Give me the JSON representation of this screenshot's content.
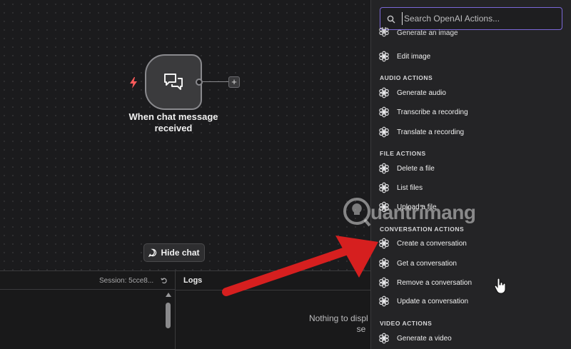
{
  "canvas": {
    "trigger_node": {
      "label": "When chat message received",
      "icon": "chat-bubbles-icon"
    },
    "hide_chat_button": {
      "label": "Hide chat",
      "icon": "chat-icon"
    }
  },
  "bottom_panel": {
    "session_label": "Session: 5cce8...",
    "logs_title": "Logs",
    "empty_message": "Nothing to displ workflow to se"
  },
  "actions_panel": {
    "search": {
      "placeholder": "Search OpenAI Actions...",
      "value": ""
    },
    "partial_top_item": "Generate an image",
    "image_actions": [
      {
        "label": "Edit image",
        "icon": "openai-icon"
      }
    ],
    "audio_actions": {
      "heading": "AUDIO ACTIONS",
      "items": [
        {
          "label": "Generate audio",
          "icon": "openai-icon"
        },
        {
          "label": "Transcribe a recording",
          "icon": "openai-icon"
        },
        {
          "label": "Translate a recording",
          "icon": "openai-icon"
        }
      ]
    },
    "file_actions": {
      "heading": "FILE ACTIONS",
      "items": [
        {
          "label": "Delete a file",
          "icon": "openai-icon"
        },
        {
          "label": "List files",
          "icon": "openai-icon"
        },
        {
          "label": "Upload a file",
          "icon": "openai-icon"
        }
      ]
    },
    "conversation_actions": {
      "heading": "CONVERSATION ACTIONS",
      "items": [
        {
          "label": "Create a conversation",
          "icon": "openai-icon"
        },
        {
          "label": "Get a conversation",
          "icon": "openai-icon"
        },
        {
          "label": "Remove a conversation",
          "icon": "openai-icon"
        },
        {
          "label": "Update a conversation",
          "icon": "openai-icon"
        }
      ]
    },
    "video_actions": {
      "heading": "VIDEO ACTIONS",
      "items": [
        {
          "label": "Generate a video",
          "icon": "openai-icon"
        }
      ]
    }
  },
  "watermark": {
    "text": "uantrimang"
  },
  "colors": {
    "accent": "#7b68d8",
    "annotation_arrow": "#d61f1f",
    "trigger_bolt": "#ff5a5a"
  }
}
